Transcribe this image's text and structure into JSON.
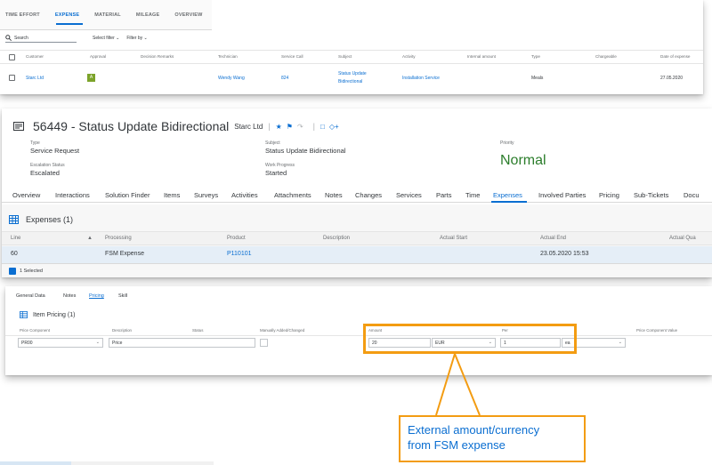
{
  "top_list": {
    "tabs": [
      "TIME EFFORT",
      "EXPENSE",
      "MATERIAL",
      "MILEAGE",
      "OVERVIEW"
    ],
    "active_tab_index": 1,
    "search_placeholder": "Search",
    "select_filter": "Select filter",
    "filter_by": "Filter by",
    "columns": [
      "Customer",
      "Approval",
      "Decision Remarks",
      "Technician",
      "Service Call",
      "Subject",
      "Activity",
      "Internal amount",
      "Type",
      "Chargeable",
      "Date of expense"
    ],
    "row": {
      "customer": "Starc Ltd",
      "approval": "A",
      "technician": "Wendy Wang",
      "service_call": "824",
      "subject_line1": "Status Update",
      "subject_line2": "Bidirectional",
      "activity": "Installation Service",
      "type": "Meals",
      "date": "27.05.2020"
    }
  },
  "ticket": {
    "title": "56449 - Status Update Bidirectional",
    "customer": "Starc Ltd",
    "type_label": "Type",
    "type_value": "Service Request",
    "escalation_label": "Escalation Status",
    "escalation_value": "Escalated",
    "subject_label": "Subject",
    "subject_value": "Status Update Bidirectional",
    "progress_label": "Work Progress",
    "progress_value": "Started",
    "priority_label": "Priority",
    "priority_value": "Normal",
    "nav_tabs": [
      "Overview",
      "Interactions",
      "Solution Finder",
      "Items",
      "Surveys",
      "Activities",
      "Attachments",
      "Notes",
      "Changes",
      "Services",
      "Parts",
      "Time",
      "Expenses",
      "Involved Parties",
      "Pricing",
      "Sub-Tickets",
      "Docu"
    ],
    "active_nav_index": 12,
    "expenses_title": "Expenses",
    "expenses_count": "(1)",
    "expense_columns": [
      "Line",
      "Processing",
      "Product",
      "Description",
      "Actual Start",
      "Actual End",
      "Actual Qua"
    ],
    "expense_row": {
      "line": "60",
      "processing": "FSM Expense",
      "product": "P110101",
      "actual_end": "23.05.2020 15:53"
    },
    "selected_text": "1 Selected"
  },
  "item_detail": {
    "tabs": [
      "General Data",
      "Notes",
      "Pricing",
      "Skill"
    ],
    "active_tab_index": 2,
    "pricing_title": "Item Pricing",
    "pricing_count": "(1)",
    "columns": [
      "Price Component",
      "Description",
      "Status",
      "Manually Added/Changed",
      "Amount",
      "Per",
      "Price Component Value"
    ],
    "row": {
      "price_component": "PR00",
      "description": "Price",
      "amount": "20",
      "currency": "EUR",
      "per": "1",
      "unit": "ea"
    }
  },
  "callout": {
    "line1": "External amount/currency",
    "line2": "from FSM expense"
  },
  "colors": {
    "accent": "#0a6ed1",
    "highlight": "#f39c12",
    "priority_green": "#2b7d2b"
  }
}
